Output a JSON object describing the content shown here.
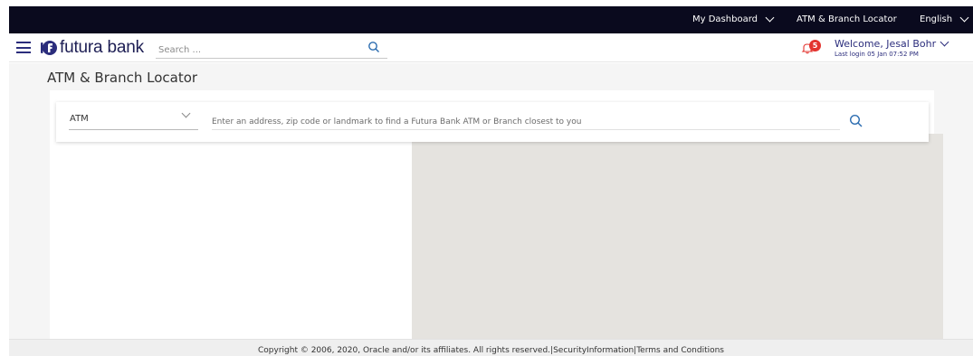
{
  "topbar": {
    "dashboard_label": "My Dashboard",
    "locator_label": "ATM & Branch Locator",
    "language_label": "English"
  },
  "header": {
    "brand_name": "futura bank",
    "search_placeholder": "Search ...",
    "notification_count": "5",
    "welcome_text": "Welcome, Jesal Bohr",
    "last_login": "Last login 05 Jan 07:52 PM"
  },
  "page": {
    "title": "ATM & Branch Locator"
  },
  "locator": {
    "type_selected": "ATM",
    "address_placeholder": "Enter an address, zip code or landmark to find a Futura Bank ATM or Branch closest to you"
  },
  "footer": {
    "copyright": "Copyright © 2006, 2020, Oracle and/or its affiliates. All rights reserved.",
    "security_link": "SecurityInformation",
    "terms_link": "Terms and Conditions",
    "separator": "|"
  },
  "colors": {
    "topbar_bg": "#0a0a1e",
    "brand": "#2b2d7c",
    "badge": "#e3342f",
    "map_bg": "#e5e3df",
    "search_icon": "#2b6cb0"
  },
  "icons": [
    "hamburger-icon",
    "futura-logo-icon",
    "search-icon",
    "bell-icon",
    "chevron-down-icon"
  ]
}
